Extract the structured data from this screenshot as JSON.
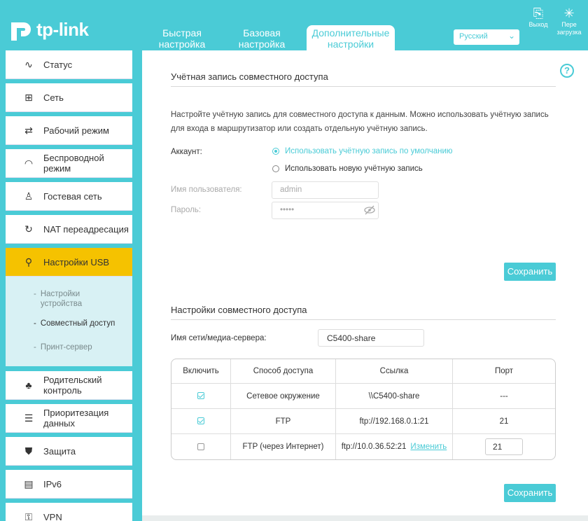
{
  "header": {
    "logo_text": "tp-link",
    "tabs": [
      {
        "label": "Быстрая настройка"
      },
      {
        "label": "Базовая настройка"
      },
      {
        "label": "Дополнительные настройки"
      }
    ],
    "language": "Русский",
    "logout_label": "Выход",
    "reboot_label": "Пере загрузка"
  },
  "sidebar": {
    "items": [
      {
        "label": "Статус",
        "icon": "pulse-icon"
      },
      {
        "label": "Сеть",
        "icon": "network-icon"
      },
      {
        "label": "Рабочий режим",
        "icon": "mode-icon"
      },
      {
        "label": "Беспроводной режим",
        "icon": "wifi-icon"
      },
      {
        "label": "Гостевая сеть",
        "icon": "guest-icon"
      },
      {
        "label": "NAT переадресация",
        "icon": "nat-icon"
      },
      {
        "label": "Настройки USB",
        "icon": "usb-icon"
      },
      {
        "label": "Родительский контроль",
        "icon": "parental-icon"
      },
      {
        "label": "Приоритезация данных",
        "icon": "qos-icon"
      },
      {
        "label": "Защита",
        "icon": "shield-icon"
      },
      {
        "label": "IPv6",
        "icon": "ipv6-icon"
      },
      {
        "label": "VPN",
        "icon": "vpn-icon"
      }
    ],
    "sub_items": [
      {
        "label": "Настройки устройства"
      },
      {
        "label": "Совместный доступ"
      },
      {
        "label": "Принт-сервер"
      }
    ]
  },
  "account": {
    "title": "Учётная запись совместного доступа",
    "description": "Настройте учётную запись для совместного доступа к данным. Можно использовать учётную запись для входа в маршрутизатор или создать отдельную учётную запись.",
    "account_label": "Аккаунт:",
    "option_default": "Использовать учётную запись по умолчанию",
    "option_new": "Использовать новую учётную запись",
    "username_label": "Имя пользователя:",
    "username_value": "admin",
    "password_label": "Пароль:",
    "password_value": "•••••",
    "save": "Сохранить"
  },
  "sharing": {
    "title": "Настройки совместного доступа",
    "server_label": "Имя сети/медиа-сервера:",
    "server_value": "C5400-share",
    "columns": [
      "Включить",
      "Способ доступа",
      "Ссылка",
      "Порт"
    ],
    "rows": [
      {
        "enabled": true,
        "method": "Сетевое окружение",
        "link": "\\\\C5400-share",
        "port": "---"
      },
      {
        "enabled": true,
        "method": "FTP",
        "link": "ftp://192.168.0.1:21",
        "port": "21"
      },
      {
        "enabled": false,
        "method": "FTP (через Интернет)",
        "link": "ftp://10.0.36.52:21",
        "edit": "Изменить",
        "port": "21"
      }
    ],
    "save": "Сохранить"
  },
  "colors": {
    "accent": "#4acbd6",
    "active_nav": "#f5c200"
  }
}
